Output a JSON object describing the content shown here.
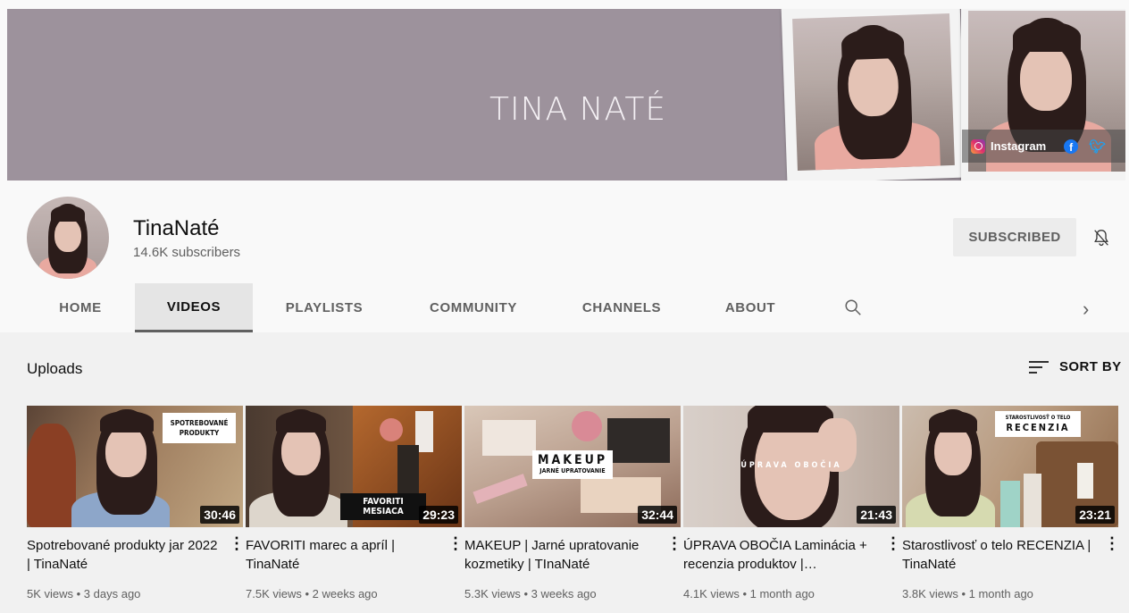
{
  "banner": {
    "title": "TINA NATÉ",
    "social": {
      "instagram_label": "Instagram",
      "icons": [
        "instagram-icon",
        "facebook-icon",
        "twitter-icon"
      ]
    },
    "background_color": "#9d929c"
  },
  "channel": {
    "name": "TinaNaté",
    "subscribers": "14.6K subscribers",
    "subscribed_label": "SUBSCRIBED"
  },
  "tabs": [
    {
      "label": "HOME"
    },
    {
      "label": "VIDEOS",
      "active": true
    },
    {
      "label": "PLAYLISTS"
    },
    {
      "label": "COMMUNITY"
    },
    {
      "label": "CHANNELS"
    },
    {
      "label": "ABOUT"
    }
  ],
  "section": {
    "title": "Uploads",
    "sort_label": "SORT BY"
  },
  "videos": [
    {
      "title": "Spotrebované produkty jar 2022 | TinaNaté",
      "duration": "30:46",
      "meta": "5K views • 3 days ago",
      "thumb_text": "SPOTREBOVANÉ PRODUKTY"
    },
    {
      "title": "FAVORITI marec a apríl | TinaNaté",
      "duration": "29:23",
      "meta": "7.5K views • 2 weeks ago",
      "thumb_text": "FAVORITI MESIACA"
    },
    {
      "title": "MAKEUP | Jarné upratovanie kozmetiky | TInaNaté",
      "duration": "32:44",
      "meta": "5.3K views • 3 weeks ago",
      "thumb_text": "MAKEUP",
      "thumb_subtext": "JARNÉ UPRATOVANIE"
    },
    {
      "title": "ÚPRAVA OBOČIA Laminácia + recenzia produktov |…",
      "duration": "21:43",
      "meta": "4.1K views • 1 month ago",
      "thumb_text": "ÚPRAVA OBOČIA"
    },
    {
      "title": "Starostlivosť o telo RECENZIA | TinaNaté",
      "duration": "23:21",
      "meta": "3.8K views • 1 month ago",
      "thumb_text": "STAROSTLIVOSŤ O TELO",
      "thumb_subtext": "RECENZIA"
    }
  ]
}
